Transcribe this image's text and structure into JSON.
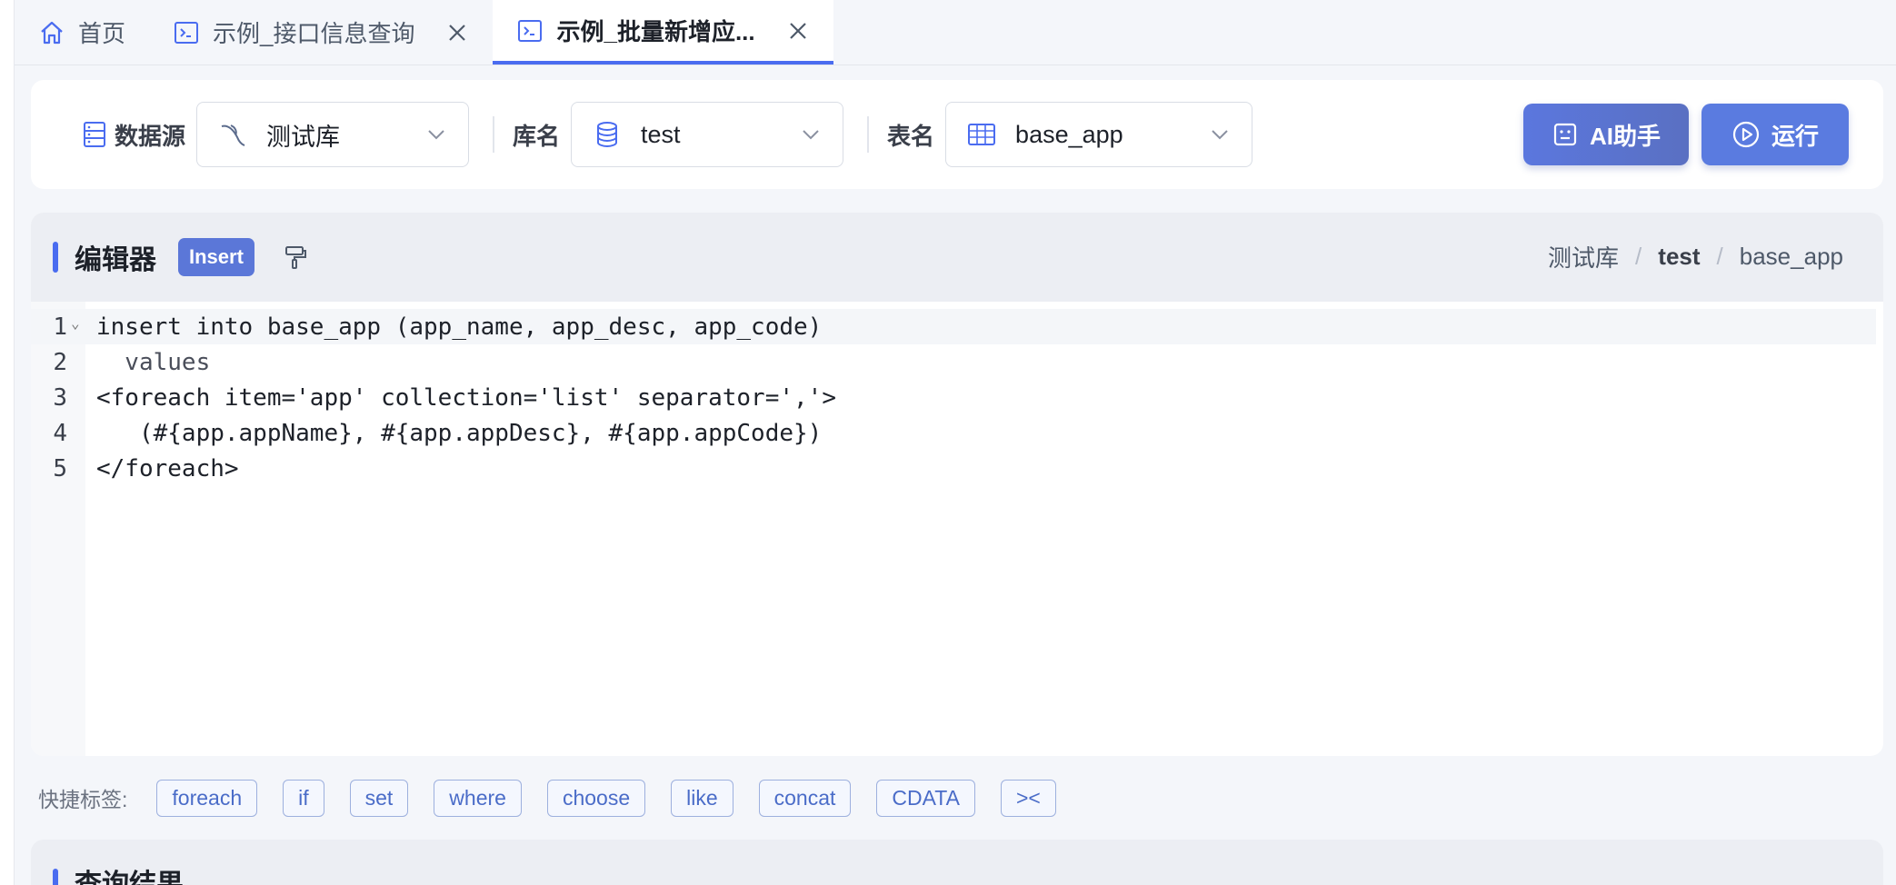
{
  "tabs": [
    {
      "label": "首页",
      "icon": "home-icon",
      "active": false,
      "closable": false
    },
    {
      "label": "示例_接口信息查询",
      "icon": "terminal-icon",
      "active": false,
      "closable": true
    },
    {
      "label": "示例_批量新增应...",
      "icon": "terminal-icon",
      "active": true,
      "closable": true
    }
  ],
  "toolbar": {
    "datasource_label": "数据源",
    "datasource_value": "测试库",
    "database_label": "库名",
    "database_value": "test",
    "table_label": "表名",
    "table_value": "base_app",
    "ai_button": "AI助手",
    "run_button": "运行"
  },
  "editor": {
    "title": "编辑器",
    "badge": "Insert",
    "breadcrumb": [
      "测试库",
      "test",
      "base_app"
    ],
    "lines": [
      {
        "num": "1",
        "text": "insert into base_app (app_name, app_desc, app_code)"
      },
      {
        "num": "2",
        "text": "  values"
      },
      {
        "num": "3",
        "text": "<foreach item='app' collection='list' separator=','>"
      },
      {
        "num": "4",
        "text": "   (#{app.appName}, #{app.appDesc}, #{app.appCode})"
      },
      {
        "num": "5",
        "text": "</foreach>"
      }
    ]
  },
  "quick_tags": {
    "label": "快捷标签:",
    "items": [
      "foreach",
      "if",
      "set",
      "where",
      "choose",
      "like",
      "concat",
      "CDATA",
      "><"
    ]
  },
  "results": {
    "title": "查询结果"
  },
  "colors": {
    "accent": "#4a6cf0",
    "button": "#5a7be0",
    "tag_border": "#9db0de"
  }
}
